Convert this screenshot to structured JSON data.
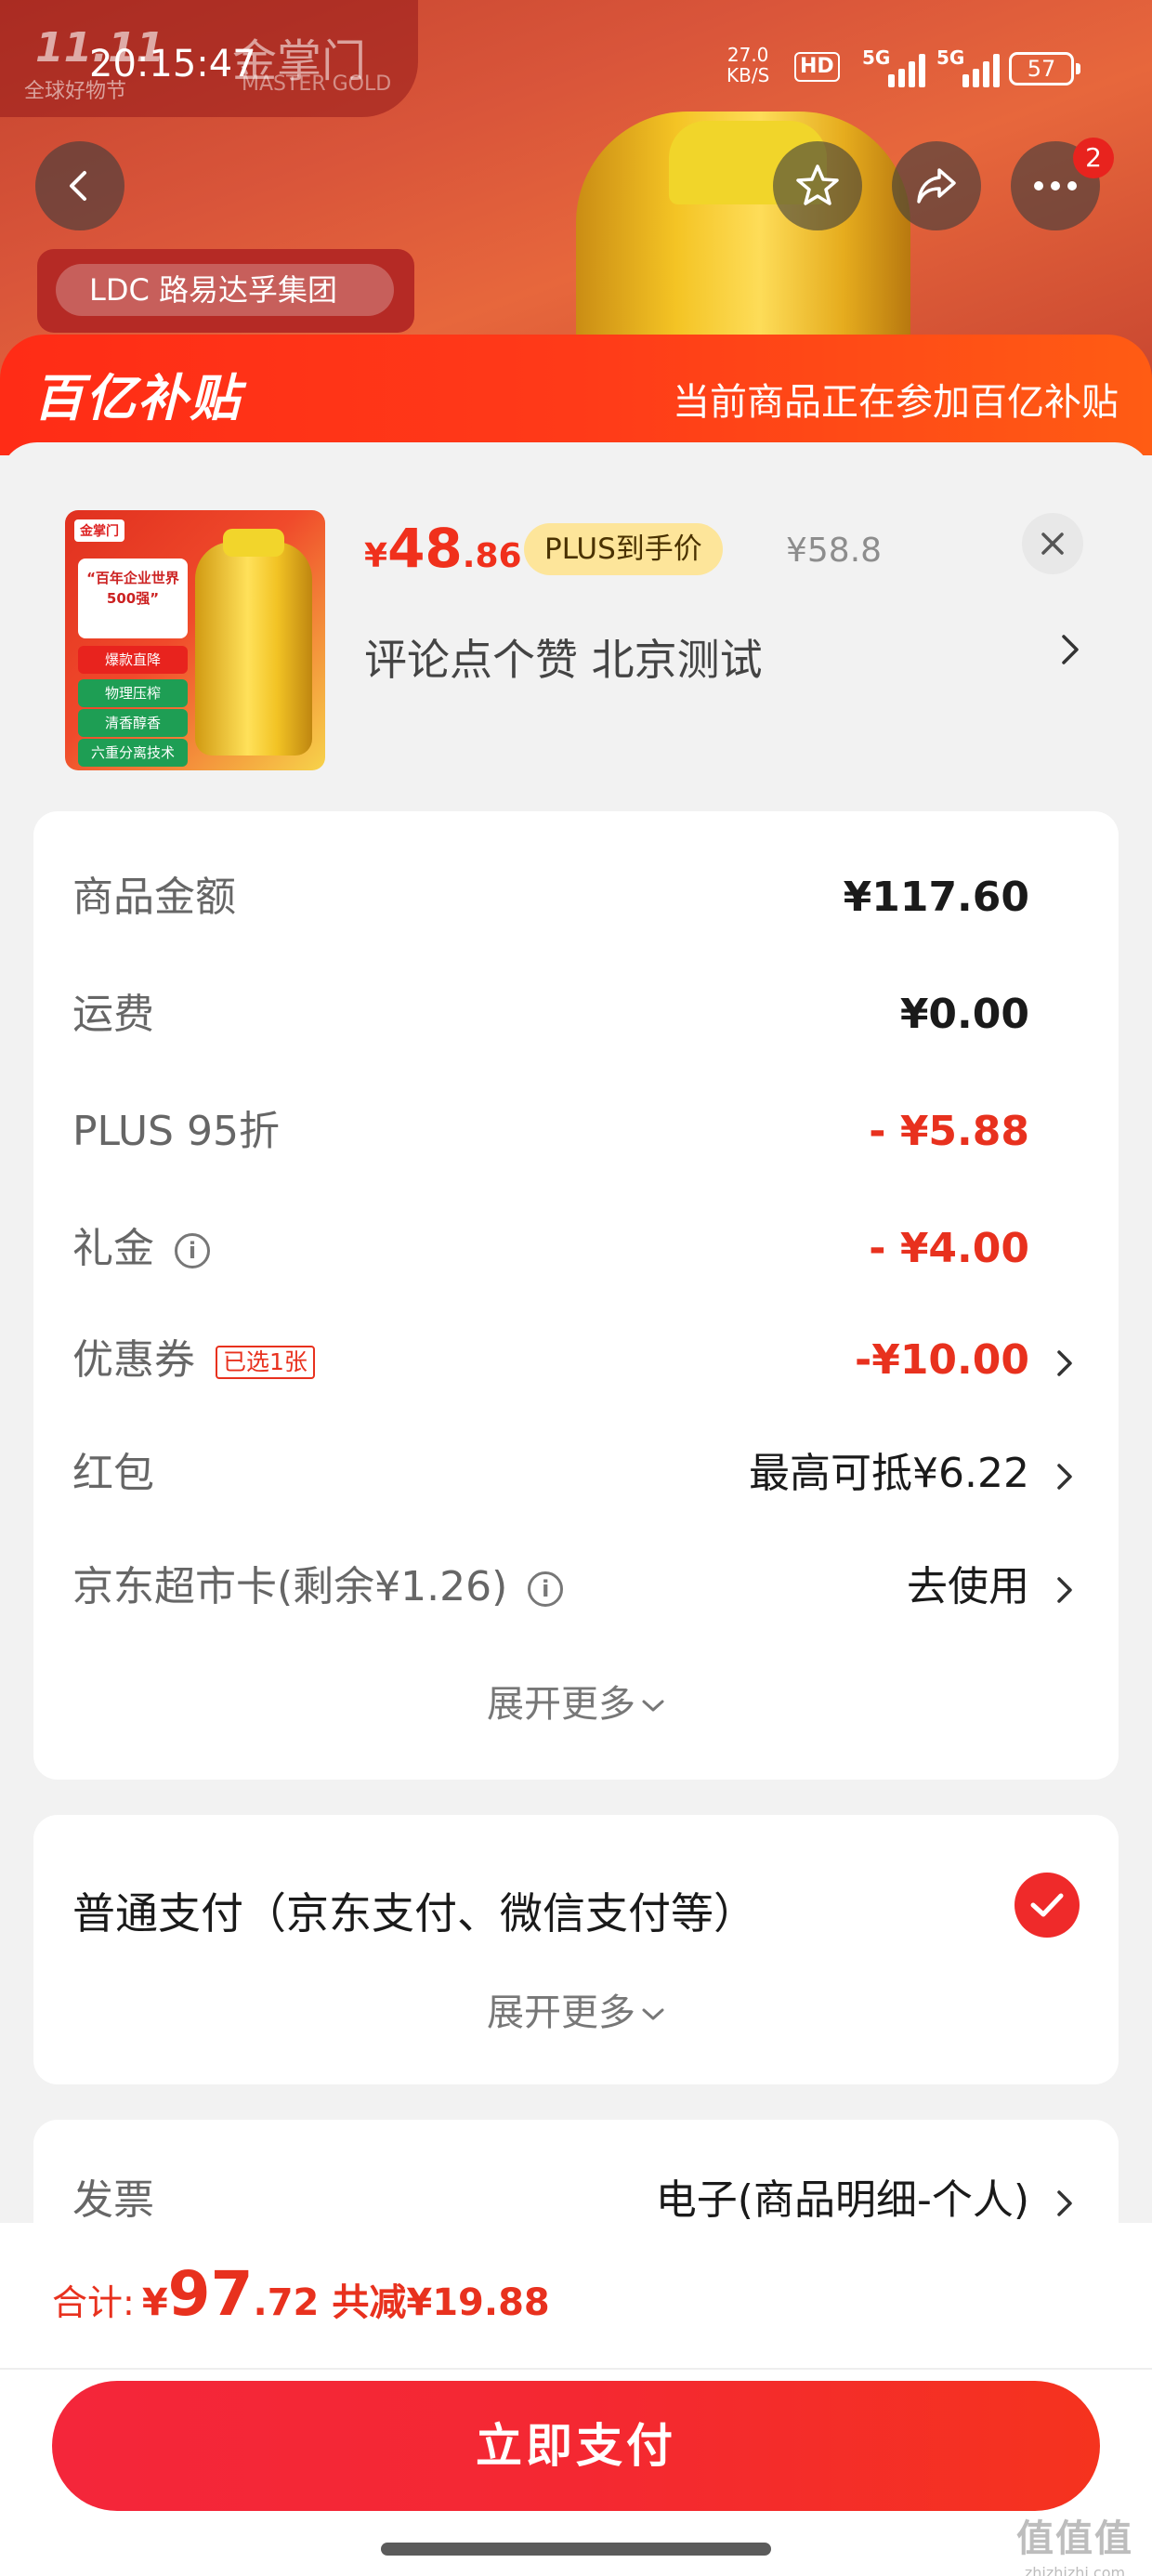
{
  "status_bar": {
    "time": "20:15:47",
    "net_speed_value": "27.0",
    "net_speed_unit": "KB/S",
    "hd": "HD",
    "sig1": "5G",
    "sig2": "5G",
    "battery": "57"
  },
  "background": {
    "promo_badge": "11.11",
    "promo_sub": "全球好物节",
    "brand_cn": "金掌门",
    "brand_en": "MASTER GOLD",
    "ldc_label": "LDC  路易达孚集团",
    "more_badge": "2"
  },
  "sheet_header": {
    "logo": "百亿补贴",
    "note": "当前商品正在参加百亿补贴"
  },
  "product": {
    "price_currency": "¥",
    "price_int": "48",
    "price_dec": ".86",
    "plus_tag": "PLUS到手价",
    "original_price": "¥58.8",
    "name": "评论点个赞  北京测试",
    "img_tag": "金掌门",
    "img_box": "“百年企业世界500强”",
    "img_tags": [
      "爆款直降",
      "物理压榨",
      "清香醇香",
      "六重分离技术"
    ]
  },
  "price_breakdown": {
    "rows": [
      {
        "label": "商品金额",
        "value": "¥117.60"
      },
      {
        "label": "运费",
        "value": "¥0.00"
      },
      {
        "label": "PLUS 95折",
        "value": "- ¥5.88"
      },
      {
        "label": "礼金",
        "value": "- ¥4.00"
      },
      {
        "label": "优惠券",
        "tag": "已选1张",
        "value": "-¥10.00"
      },
      {
        "label": "红包",
        "value": "最高可抵¥6.22"
      },
      {
        "label": "京东超市卡(剩余¥1.26)",
        "value": "去使用"
      }
    ],
    "expand": "展开更多"
  },
  "payment": {
    "label": "普通支付（京东支付、微信支付等）",
    "expand": "展开更多"
  },
  "invoice": {
    "label": "发票",
    "value": "电子(商品明细-个人)"
  },
  "footer": {
    "total_label": "合计:",
    "currency": "¥",
    "total_int": "97",
    "total_dec": ".72",
    "saved": "共减¥19.88",
    "pay_button": "立即支付",
    "watermark_big": "值值值",
    "watermark_small": "zhizhizhi.com"
  },
  "colors": {
    "accent_red": "#e8311e",
    "header_orange": "#ff3a18",
    "plus_gold": "#fde59a"
  },
  "icons": [
    "back-arrow-icon",
    "star-icon",
    "share-icon",
    "more-icon",
    "close-icon",
    "chevron-right-icon",
    "info-icon",
    "chevron-down-icon",
    "check-icon"
  ]
}
